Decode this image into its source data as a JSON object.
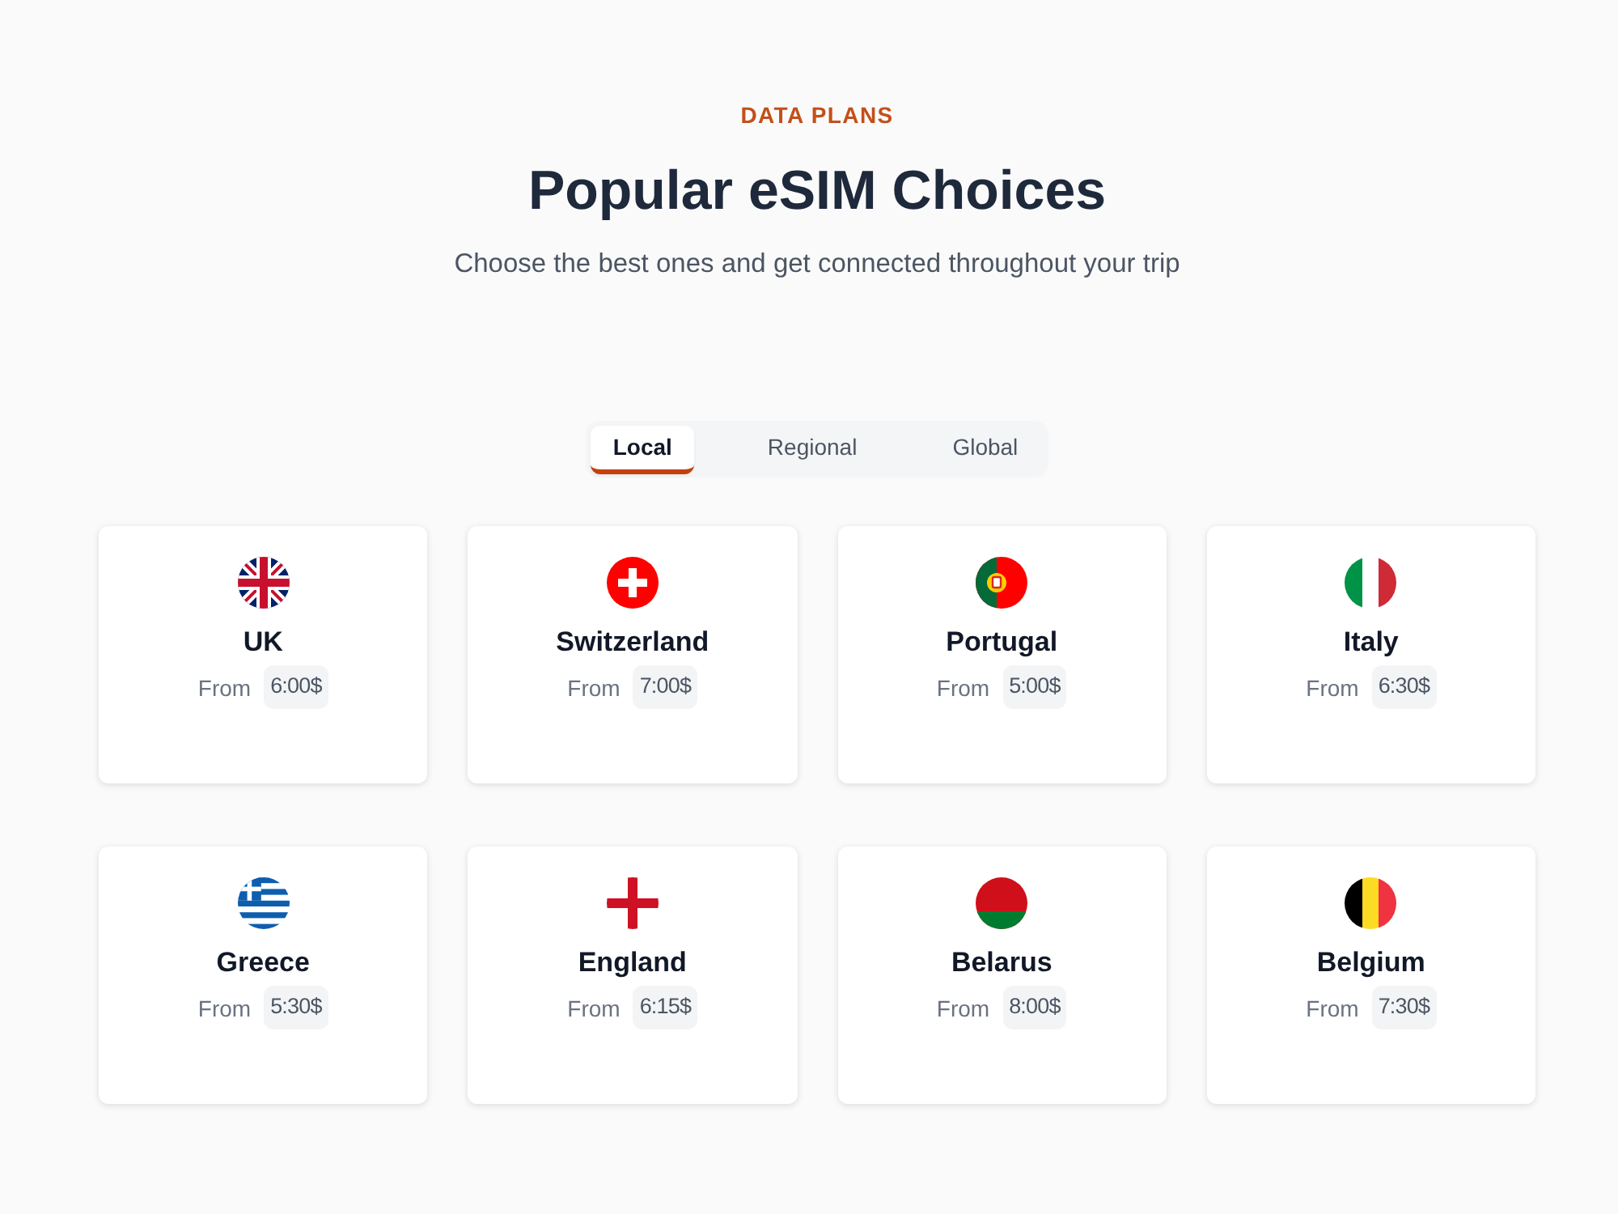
{
  "header": {
    "eyebrow": "DATA PLANS",
    "title": "Popular eSIM Choices",
    "subtitle": "Choose the best ones and get connected throughout your trip"
  },
  "tabs": [
    {
      "label": "Local",
      "selected": true
    },
    {
      "label": "Regional",
      "selected": false
    },
    {
      "label": "Global",
      "selected": false
    }
  ],
  "plans": [
    {
      "kind": "uk",
      "country": "UK",
      "from_label": "From",
      "price": "6:00$"
    },
    {
      "kind": "swiss",
      "country": "Switzerland",
      "from_label": "From",
      "price": "7:00$"
    },
    {
      "kind": "portugal",
      "country": "Portugal",
      "from_label": "From",
      "price": "5:00$"
    },
    {
      "kind": "italy",
      "country": "Italy",
      "from_label": "From",
      "price": "6:30$"
    },
    {
      "kind": "greece",
      "country": "Greece",
      "from_label": "From",
      "price": "5:30$"
    },
    {
      "kind": "england",
      "country": "England",
      "from_label": "From",
      "price": "6:15$"
    },
    {
      "kind": "belarus",
      "country": "Belarus",
      "from_label": "From",
      "price": "8:00$"
    },
    {
      "kind": "belgium",
      "country": "Belgium",
      "from_label": "From",
      "price": "7:30$"
    }
  ]
}
